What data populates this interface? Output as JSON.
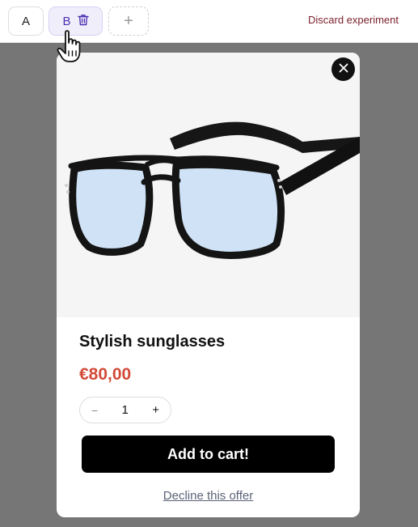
{
  "topbar": {
    "variant_a_label": "A",
    "variant_b_label": "B",
    "add_variant_label": "+",
    "discard_label": "Discard experiment"
  },
  "product": {
    "title": "Stylish sunglasses",
    "price": "€80,00",
    "quantity": "1",
    "add_to_cart_label": "Add to cart!",
    "decline_label": "Decline this offer"
  },
  "colors": {
    "price": "#d24a37",
    "accent_variant": "#4b2fb0",
    "discard": "#7a1f2b",
    "overlay": "#767676"
  },
  "icons": [
    "trash-icon",
    "close-icon",
    "hand-cursor-icon",
    "minus-icon",
    "plus-icon"
  ]
}
